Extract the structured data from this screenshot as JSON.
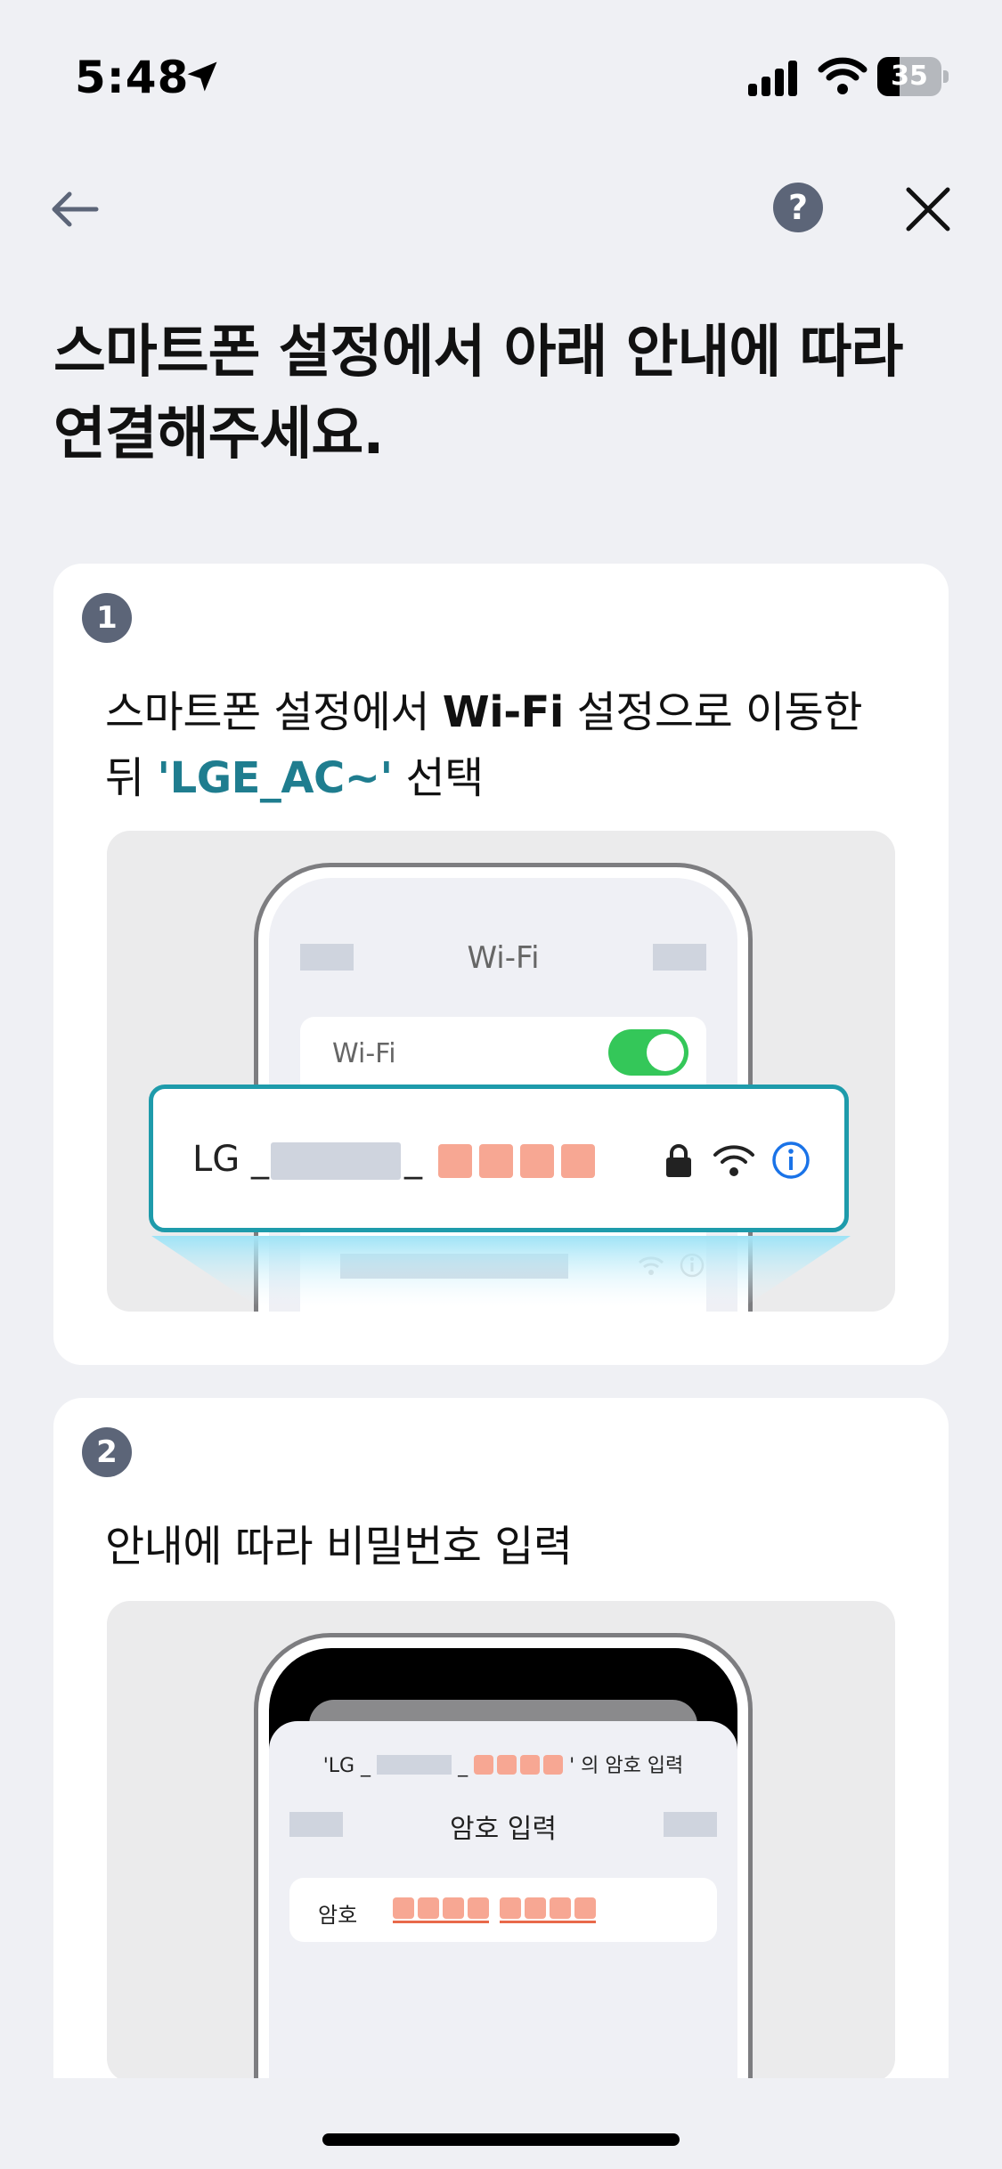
{
  "status_bar": {
    "time": "5:48",
    "battery": "35",
    "battery_level": 0.35
  },
  "nav": {
    "help_label": "?"
  },
  "title": "스마트폰 설정에서 아래 안내에 따라 연결해주세요.",
  "step1": {
    "number": "1",
    "text_prefix": "스마트폰 설정에서 ",
    "text_wifi": "Wi-Fi",
    "text_mid": " 설정으로 이동한 뒤 ",
    "text_network": "'LGE_AC~'",
    "text_suffix": " 선택",
    "illustration": {
      "screen_title": "Wi-Fi",
      "wifi_row_label": "Wi-Fi",
      "toggle_on": true,
      "network_prefix": "LG _",
      "network_sep": "_"
    }
  },
  "step2": {
    "number": "2",
    "text": "안내에 따라 비밀번호 입력",
    "illustration": {
      "dialog_prefix": "'LG _",
      "dialog_sep": "_",
      "dialog_suffix": "' 의 암호 입력",
      "screen_title": "암호 입력",
      "password_label": "암호"
    }
  },
  "colors": {
    "accent": "#1f7d8f",
    "badge": "#5c6578",
    "toggle": "#34c759",
    "masked_char": "#f7a793",
    "masked_block": "#cfd4de",
    "info": "#1a73e8"
  }
}
